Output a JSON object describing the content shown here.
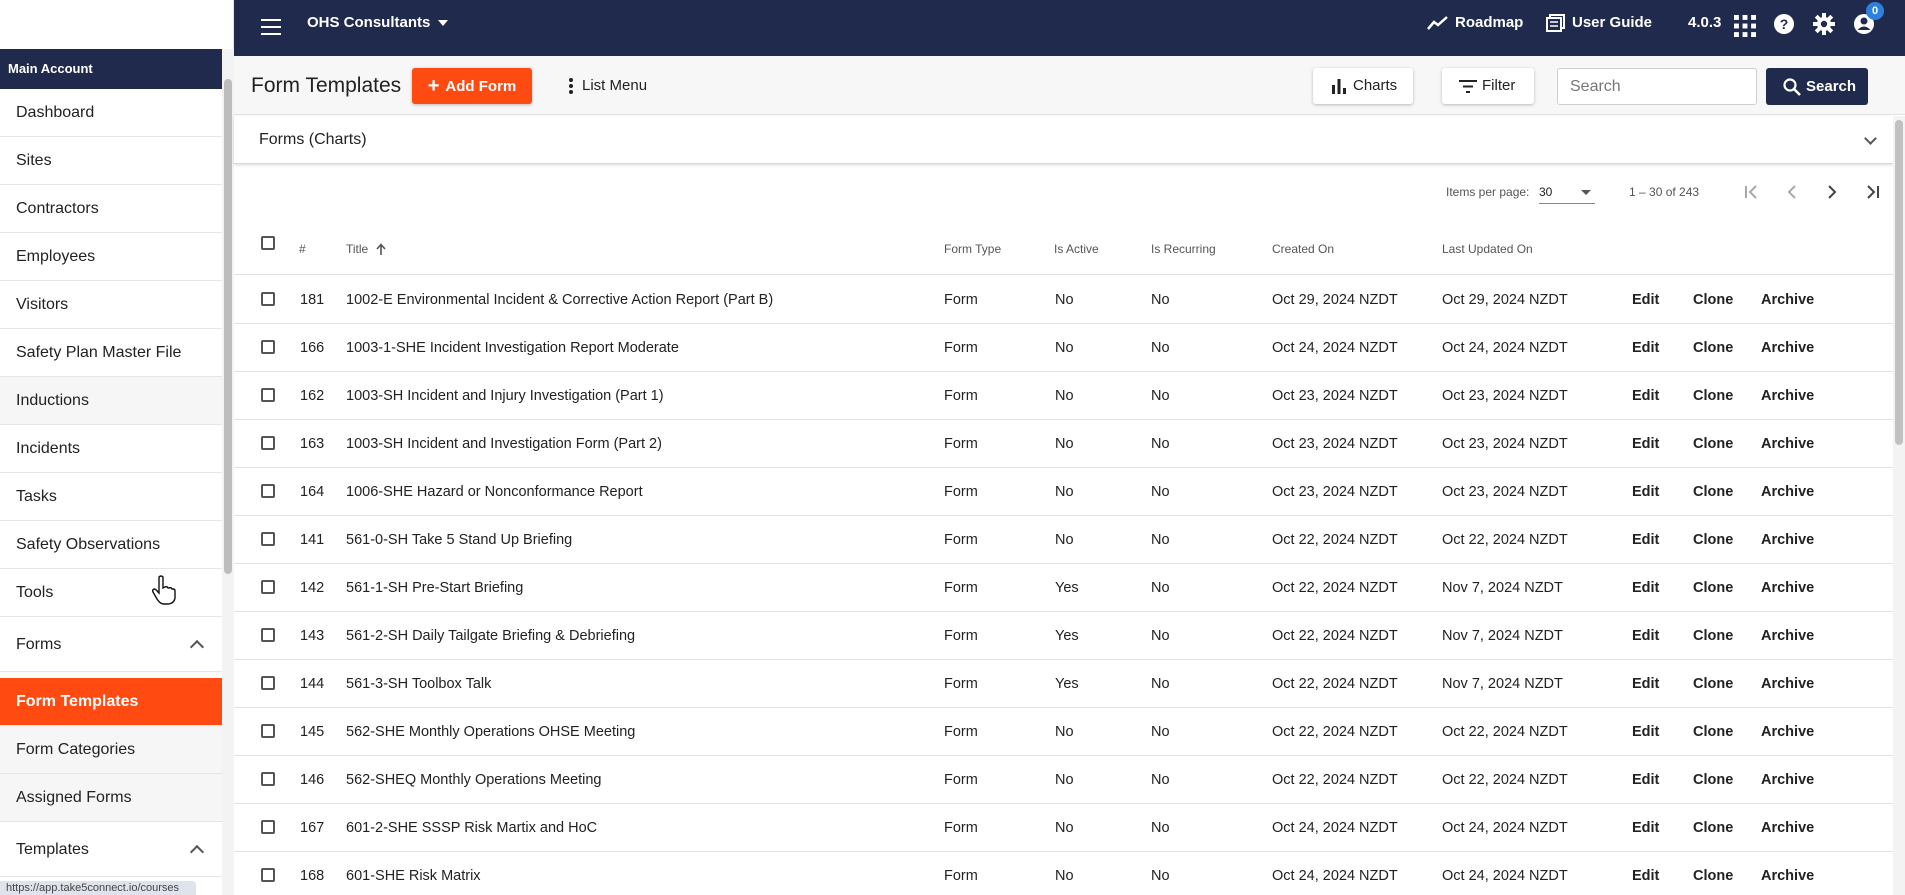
{
  "topbar": {
    "org_name": "OHS Consultants",
    "roadmap_label": "Roadmap",
    "user_guide_label": "User Guide",
    "version": "4.0.3",
    "notification_count": "0"
  },
  "sidebar": {
    "header": "Main Account",
    "items": [
      {
        "label": "Dashboard"
      },
      {
        "label": "Sites"
      },
      {
        "label": "Contractors"
      },
      {
        "label": "Employees"
      },
      {
        "label": "Visitors"
      },
      {
        "label": "Safety Plan Master File"
      },
      {
        "label": "Inductions"
      },
      {
        "label": "Incidents"
      },
      {
        "label": "Tasks"
      },
      {
        "label": "Safety Observations"
      },
      {
        "label": "Tools"
      },
      {
        "label": "Forms"
      },
      {
        "label": "Form Templates"
      },
      {
        "label": "Form Categories"
      },
      {
        "label": "Assigned Forms"
      },
      {
        "label": "Templates"
      }
    ],
    "status_url": "https://app.take5connect.io/courses"
  },
  "toolbar": {
    "title": "Form Templates",
    "add_label": "Add Form",
    "list_menu_label": "List Menu",
    "charts_label": "Charts",
    "filter_label": "Filter",
    "search_placeholder": "Search",
    "search_label": "Search"
  },
  "charts_panel": {
    "title": "Forms (Charts)"
  },
  "paginator": {
    "items_per_page_label": "Items per page:",
    "items_per_page": "30",
    "range": "1 – 30 of 243"
  },
  "table": {
    "columns": [
      "#",
      "Title",
      "Form Type",
      "Is Active",
      "Is Recurring",
      "Created On",
      "Last Updated On"
    ],
    "actions": [
      "Edit",
      "Clone",
      "Archive"
    ],
    "rows": [
      {
        "num": "181",
        "title": "1002-E Environmental Incident & Corrective Action Report (Part B)",
        "type": "Form",
        "active": "No",
        "recurring": "No",
        "created": "Oct 29, 2024 NZDT",
        "updated": "Oct 29, 2024 NZDT"
      },
      {
        "num": "166",
        "title": "1003-1-SHE Incident Investigation Report Moderate",
        "type": "Form",
        "active": "No",
        "recurring": "No",
        "created": "Oct 24, 2024 NZDT",
        "updated": "Oct 24, 2024 NZDT"
      },
      {
        "num": "162",
        "title": "1003-SH Incident and Injury Investigation (Part 1)",
        "type": "Form",
        "active": "No",
        "recurring": "No",
        "created": "Oct 23, 2024 NZDT",
        "updated": "Oct 23, 2024 NZDT"
      },
      {
        "num": "163",
        "title": "1003-SH Incident and Investigation Form (Part 2)",
        "type": "Form",
        "active": "No",
        "recurring": "No",
        "created": "Oct 23, 2024 NZDT",
        "updated": "Oct 23, 2024 NZDT"
      },
      {
        "num": "164",
        "title": "1006-SHE Hazard or Nonconformance Report",
        "type": "Form",
        "active": "No",
        "recurring": "No",
        "created": "Oct 23, 2024 NZDT",
        "updated": "Oct 23, 2024 NZDT"
      },
      {
        "num": "141",
        "title": "561-0-SH Take 5 Stand Up Briefing",
        "type": "Form",
        "active": "No",
        "recurring": "No",
        "created": "Oct 22, 2024 NZDT",
        "updated": "Oct 22, 2024 NZDT"
      },
      {
        "num": "142",
        "title": "561-1-SH Pre-Start Briefing",
        "type": "Form",
        "active": "Yes",
        "recurring": "No",
        "created": "Oct 22, 2024 NZDT",
        "updated": "Nov 7, 2024 NZDT"
      },
      {
        "num": "143",
        "title": "561-2-SH Daily Tailgate Briefing & Debriefing",
        "type": "Form",
        "active": "Yes",
        "recurring": "No",
        "created": "Oct 22, 2024 NZDT",
        "updated": "Nov 7, 2024 NZDT"
      },
      {
        "num": "144",
        "title": "561-3-SH Toolbox Talk",
        "type": "Form",
        "active": "Yes",
        "recurring": "No",
        "created": "Oct 22, 2024 NZDT",
        "updated": "Nov 7, 2024 NZDT"
      },
      {
        "num": "145",
        "title": "562-SHE Monthly Operations OHSE Meeting",
        "type": "Form",
        "active": "No",
        "recurring": "No",
        "created": "Oct 22, 2024 NZDT",
        "updated": "Oct 22, 2024 NZDT"
      },
      {
        "num": "146",
        "title": "562-SHEQ Monthly Operations Meeting",
        "type": "Form",
        "active": "No",
        "recurring": "No",
        "created": "Oct 22, 2024 NZDT",
        "updated": "Oct 22, 2024 NZDT"
      },
      {
        "num": "167",
        "title": "601-2-SHE SSSP Risk Martix and HoC",
        "type": "Form",
        "active": "No",
        "recurring": "No",
        "created": "Oct 24, 2024 NZDT",
        "updated": "Oct 24, 2024 NZDT"
      },
      {
        "num": "168",
        "title": "601-SHE Risk Matrix",
        "type": "Form",
        "active": "No",
        "recurring": "No",
        "created": "Oct 24, 2024 NZDT",
        "updated": "Oct 24, 2024 NZDT"
      }
    ]
  },
  "colors": {
    "navy": "#1f2a4c",
    "accent": "#ff4a12",
    "badge": "#2d7fe0"
  },
  "icons": [
    "menu-icon",
    "roadmap-icon",
    "user-guide-icon",
    "apps-grid-icon",
    "help-icon",
    "settings-icon",
    "account-icon",
    "plus-icon",
    "kebab-icon",
    "charts-icon",
    "filter-icon",
    "search-icon",
    "chevron-down-icon",
    "first-page-icon",
    "prev-page-icon",
    "next-page-icon",
    "last-page-icon"
  ]
}
